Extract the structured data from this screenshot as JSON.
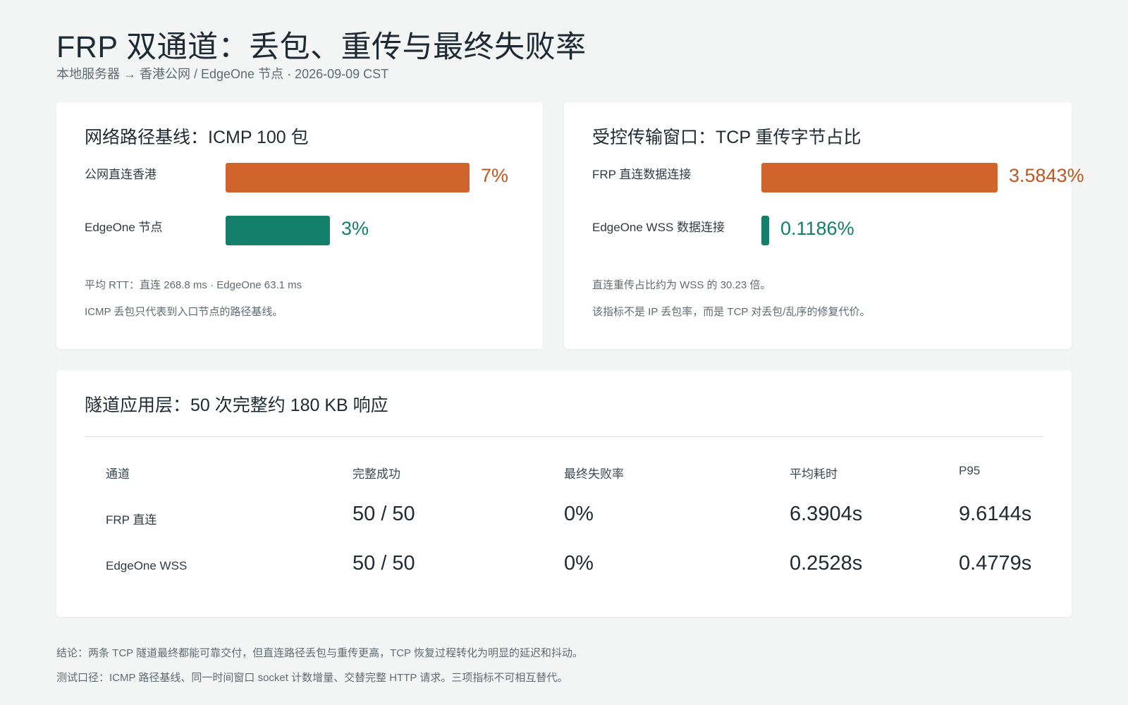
{
  "title": "FRP 双通道：丢包、重传与最终失败率",
  "subtitle": "本地服务器 → 香港公网 / EdgeOne 节点 · 2026-09-09 CST",
  "colors": {
    "direct": "#d1642c",
    "edgeone": "#14806b"
  },
  "chart_data": [
    {
      "type": "bar",
      "orientation": "horizontal",
      "title": "网络路径基线：ICMP 100 包",
      "categories": [
        "公网直连香港",
        "EdgeOne 节点"
      ],
      "values": [
        7,
        3
      ],
      "value_labels": [
        "7%",
        "3%"
      ],
      "unit": "%",
      "notes": [
        "平均 RTT：直连 268.8 ms · EdgeOne 63.1 ms",
        "ICMP 丢包只代表到入口节点的路径基线。"
      ]
    },
    {
      "type": "bar",
      "orientation": "horizontal",
      "title": "受控传输窗口：TCP 重传字节占比",
      "categories": [
        "FRP 直连数据连接",
        "EdgeOne WSS 数据连接"
      ],
      "values": [
        3.5843,
        0.1186
      ],
      "value_labels": [
        "3.5843%",
        "0.1186%"
      ],
      "unit": "%",
      "notes": [
        "直连重传占比约为 WSS 的 30.23 倍。",
        "该指标不是 IP 丢包率，而是 TCP 对丢包/乱序的修复代价。"
      ]
    },
    {
      "type": "table",
      "title": "隧道应用层：50 次完整约 180 KB 响应",
      "columns": [
        "通道",
        "完整成功",
        "最终失败率",
        "平均耗时",
        "P95"
      ],
      "rows": [
        [
          "FRP 直连",
          "50 / 50",
          "0%",
          "6.3904s",
          "9.6144s"
        ],
        [
          "EdgeOne WSS",
          "50 / 50",
          "0%",
          "0.2528s",
          "0.4779s"
        ]
      ]
    }
  ],
  "footer": {
    "conclusion": "结论：两条 TCP 隧道最终都能可靠交付，但直连路径丢包与重传更高，TCP 恢复过程转化为明显的延迟和抖动。",
    "method": "测试口径：ICMP 路径基线、同一时间窗口 socket 计数增量、交替完整 HTTP 请求。三项指标不可相互替代。"
  }
}
